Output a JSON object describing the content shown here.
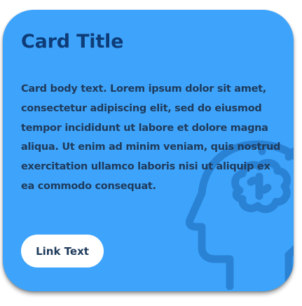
{
  "card": {
    "title": "Card Title",
    "body": "Card body text. Lorem ipsum dolor sit amet, consectetur adipiscing elit, sed do eiusmod tempor incididunt ut labore et dolore magna aliqua. Ut enim ad minim veniam, quis nostrud exercitation ullamco laboris nisi ut aliquip ex ea commodo consequat.",
    "link_label": "Link Text",
    "background_icon": "head-brain-icon"
  },
  "colors": {
    "card_background": "#3ea4fb",
    "title_text": "#0e3c78",
    "body_text": "#1f3b5c",
    "icon_stroke": "#2a82d4",
    "button_background": "#ffffff"
  }
}
